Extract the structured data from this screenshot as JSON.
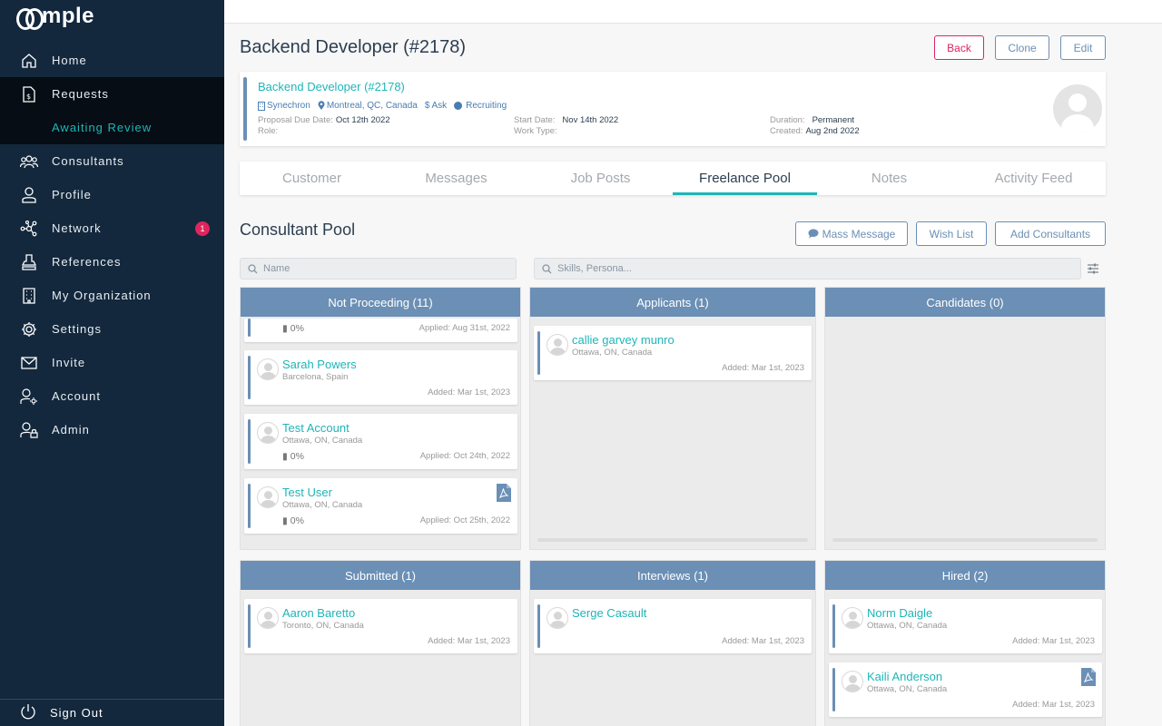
{
  "brand": {
    "logo_text": "mple"
  },
  "sidebar": {
    "items": [
      {
        "label": "Home",
        "icon": "home-icon"
      },
      {
        "label": "Requests",
        "icon": "document-dollar-icon"
      },
      {
        "label": "Consultants",
        "icon": "people-icon"
      },
      {
        "label": "Profile",
        "icon": "user-icon"
      },
      {
        "label": "Network",
        "icon": "network-icon",
        "badge": "1"
      },
      {
        "label": "References",
        "icon": "stamp-icon"
      },
      {
        "label": "My Organization",
        "icon": "building-icon"
      },
      {
        "label": "Settings",
        "icon": "gear-icon"
      },
      {
        "label": "Invite",
        "icon": "envelope-icon"
      },
      {
        "label": "Account",
        "icon": "user-gear-icon"
      },
      {
        "label": "Admin",
        "icon": "users-lock-icon"
      }
    ],
    "sub_item": "Awaiting Review",
    "signout": "Sign Out"
  },
  "header": {
    "title": "Backend Developer (#2178)",
    "back": "Back",
    "clone": "Clone",
    "edit": "Edit"
  },
  "job": {
    "name": "Backend Developer (#2178)",
    "company": "Synechron",
    "location": "Montreal, QC, Canada",
    "rate": "Ask",
    "status": "Recruiting",
    "proposal_due_label": "Proposal Due Date:",
    "proposal_due": "Oct 12th 2022",
    "role_label": "Role:",
    "role": "",
    "start_label": "Start Date:",
    "start": "Nov 14th 2022",
    "work_type_label": "Work Type:",
    "work_type": "",
    "duration_label": "Duration:",
    "duration": "Permanent",
    "created_label": "Created:",
    "created": "Aug 2nd 2022"
  },
  "tabs": [
    "Customer",
    "Messages",
    "Job Posts",
    "Freelance Pool",
    "Notes",
    "Activity Feed"
  ],
  "pool": {
    "title": "Consultant Pool",
    "mass_message": "Mass Message",
    "wish_list": "Wish List",
    "add_consultants": "Add Consultants",
    "name_placeholder": "Name",
    "skills_placeholder": "Skills, Persona..."
  },
  "columns": {
    "not_proceeding": {
      "title": "Not Proceeding (11)",
      "cards": [
        {
          "pct": "0%",
          "date": "Applied: Aug 31st, 2022"
        },
        {
          "name": "Sarah Powers",
          "loc": "Barcelona, Spain",
          "date": "Added: Mar 1st, 2023"
        },
        {
          "name": "Test Account",
          "loc": "Ottawa, ON, Canada",
          "pct": "0%",
          "date": "Applied: Oct 24th, 2022"
        },
        {
          "name": "Test User",
          "loc": "Ottawa, ON, Canada",
          "pct": "0%",
          "date": "Applied: Oct 25th, 2022"
        }
      ]
    },
    "applicants": {
      "title": "Applicants (1)",
      "cards": [
        {
          "name": "callie garvey munro",
          "loc": "Ottawa, ON, Canada",
          "date": "Added: Mar 1st, 2023"
        }
      ]
    },
    "candidates": {
      "title": "Candidates (0)"
    },
    "submitted": {
      "title": "Submitted (1)",
      "cards": [
        {
          "name": "Aaron Baretto",
          "loc": "Toronto, ON, Canada",
          "date": "Added: Mar 1st, 2023"
        }
      ]
    },
    "interviews": {
      "title": "Interviews (1)",
      "cards": [
        {
          "name": "Serge Casault",
          "date": "Added: Mar 1st, 2023"
        }
      ]
    },
    "hired": {
      "title": "Hired (2)",
      "cards": [
        {
          "name": "Norm Daigle",
          "loc": "Ottawa, ON, Canada",
          "date": "Added: Mar 1st, 2023"
        },
        {
          "name": "Kaili Anderson",
          "loc": "Ottawa, ON, Canada",
          "date": "Added: Mar 1st, 2023"
        }
      ]
    }
  },
  "colors": {
    "sidebar_bg": "#13283d",
    "accent_teal": "#1fb5b8",
    "column_header": "#6b8fb5",
    "danger": "#e0245e"
  }
}
